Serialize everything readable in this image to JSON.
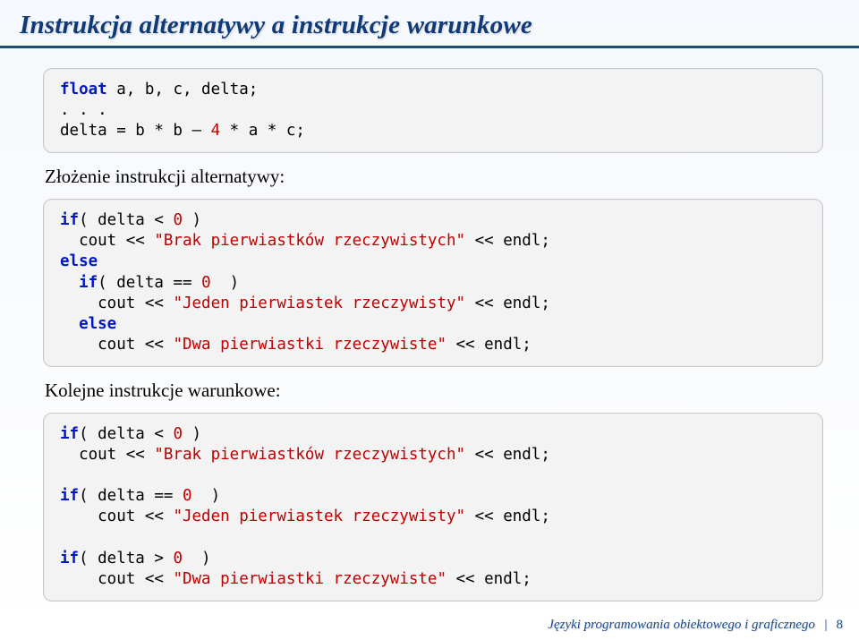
{
  "title": "Instrukcja alternatywy a instrukcje warunkowe",
  "code1": {
    "l1a": "float",
    "l1b": " a, b, c, delta;",
    "l2": ". . .",
    "l3a": "delta = b * b – ",
    "l3b": "4",
    "l3c": " * a * c;"
  },
  "label1": "Złożenie instrukcji alternatywy:",
  "code2": {
    "l1a": "if",
    "l1b": "( delta < ",
    "l1c": "0",
    "l1d": " )",
    "l2a": "  cout << ",
    "l2b": "\"Brak pierwiastków rzeczywistych\"",
    "l2c": " << endl;",
    "l3": "else",
    "l4a": "  ",
    "l4b": "if",
    "l4c": "( delta == ",
    "l4d": "0",
    "l4e": "  )",
    "l5a": "    cout << ",
    "l5b": "\"Jeden pierwiastek rzeczywisty\"",
    "l5c": " << endl;",
    "l6a": "  ",
    "l6b": "else",
    "l7a": "    cout << ",
    "l7b": "\"Dwa pierwiastki rzeczywiste\"",
    "l7c": " << endl;"
  },
  "label2": "Kolejne instrukcje warunkowe:",
  "code3": {
    "l1a": "if",
    "l1b": "( delta < ",
    "l1c": "0",
    "l1d": " )",
    "l2a": "  cout << ",
    "l2b": "\"Brak pierwiastków rzeczywistych\"",
    "l2c": " << endl;",
    "l3": "",
    "l4a": "if",
    "l4b": "( delta == ",
    "l4c": "0",
    "l4d": "  )",
    "l5a": "    cout << ",
    "l5b": "\"Jeden pierwiastek rzeczywisty\"",
    "l5c": " << endl;",
    "l6": "",
    "l7a": "if",
    "l7b": "( delta > ",
    "l7c": "0",
    "l7d": "  )",
    "l8a": "    cout << ",
    "l8b": "\"Dwa pierwiastki rzeczywiste\"",
    "l8c": " << endl;"
  },
  "footer": {
    "text": "Języki programowania obiektowego i graficznego",
    "sep": "|",
    "page": "8"
  }
}
